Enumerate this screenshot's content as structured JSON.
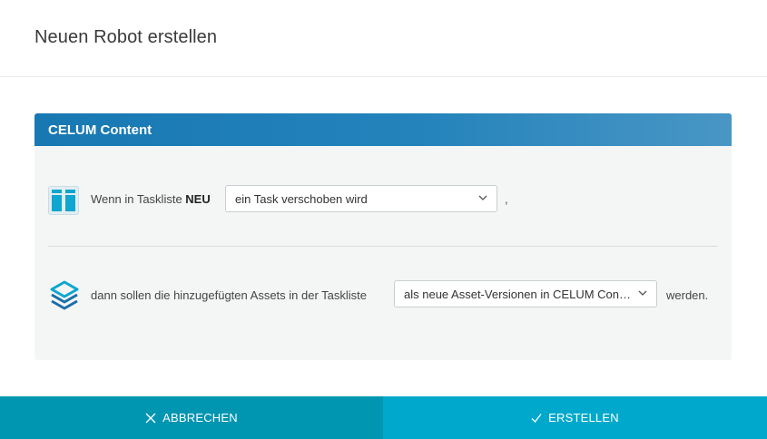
{
  "dialog": {
    "title": "Neuen Robot erstellen"
  },
  "card": {
    "header": "CELUM Content",
    "trigger": {
      "icon": "tasklist-columns-icon",
      "text_prefix": "Wenn in Taskliste ",
      "tasklist_name": "NEU",
      "select_value": "ein Task verschoben wird",
      "suffix": ","
    },
    "action": {
      "icon": "layers-stack-icon",
      "text": "dann sollen die hinzugefügten Assets in der Taskliste",
      "select_value": "als neue Asset-Versionen in CELUM Content",
      "suffix": "werden."
    }
  },
  "footer": {
    "cancel_label": "ABBRECHEN",
    "create_label": "ERSTELLEN"
  },
  "colors": {
    "card_header": "#1878b2",
    "icon_blue": "#0fa6cf",
    "cancel_bg": "#0095b0",
    "create_bg": "#00a9cc"
  }
}
